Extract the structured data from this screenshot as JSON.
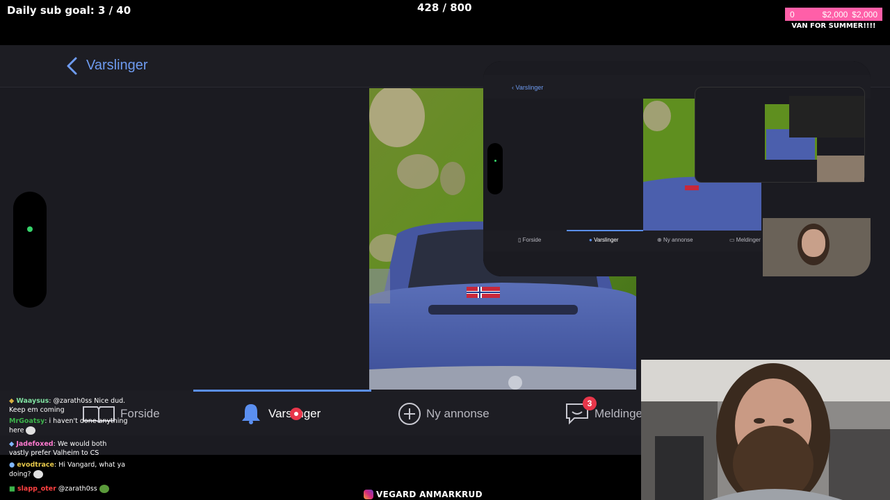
{
  "stream": {
    "sub_goal": "Daily sub goal: 3 / 40",
    "counter": "428 / 800",
    "donation": {
      "current": "0",
      "mid": "$2,000",
      "goal": "$2,000",
      "label": "VAN FOR SUMMER!!!!"
    },
    "instagram": "VEGARD ANMARKRUD"
  },
  "app": {
    "header_title": "Varslinger",
    "tabs": [
      {
        "label": "Forside",
        "icon": "book-icon"
      },
      {
        "label": "Varslinger",
        "icon": "bell-icon"
      },
      {
        "label": "Ny annonse",
        "icon": "plus-circle-icon"
      },
      {
        "label": "Meldinger",
        "icon": "message-icon",
        "badge": "3"
      }
    ]
  },
  "chat": [
    {
      "user": "Waaysus",
      "message": "@zarath0ss Nice dud. Keep em coming",
      "color": "#7fe0a0"
    },
    {
      "user": "MrGoatsy",
      "message": "i haven't done anything here",
      "color": "#3cb44b"
    },
    {
      "user": "Jadefoxed",
      "message": "We would both vastly prefer Valheim to CS",
      "color": "#ff7ad0"
    },
    {
      "user": "evodtrace",
      "message": "Hi Vangard, what ya doing?",
      "color": "#e6c84a"
    },
    {
      "user": "slapp_oter",
      "message": "@zarath0ss",
      "color": "#ff4040"
    }
  ],
  "nested": {
    "header_title": "Varslinger",
    "tabs": [
      "Forside",
      "Varslinger",
      "Ny annonse",
      "Meldinger"
    ]
  },
  "colors": {
    "accent": "#5b8ff0",
    "donation": "#ff5fa8",
    "app_bg": "#1b1b21"
  }
}
